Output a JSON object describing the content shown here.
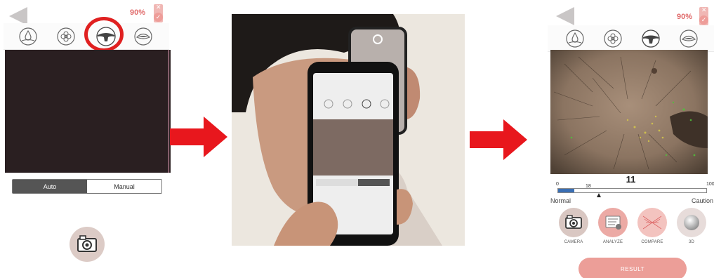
{
  "left_screen": {
    "battery": "90%",
    "modes": [
      {
        "icon": "droplet-icon"
      },
      {
        "icon": "pores-icon"
      },
      {
        "icon": "skin-layer-icon"
      },
      {
        "icon": "eye-icon"
      }
    ],
    "selected_mode_index": 2,
    "capture_modes": [
      "Auto",
      "Manual"
    ],
    "selected_capture_mode": "Auto"
  },
  "right_screen": {
    "battery": "90%",
    "score": "11",
    "scale_min": "0",
    "scale_max": "100",
    "threshold": "18",
    "score_fraction": 0.11,
    "threshold_fraction": 0.18,
    "scale_low_label": "Normal",
    "scale_high_label": "Caution",
    "actions": [
      {
        "label": "CAMERA",
        "icon": "camera-icon"
      },
      {
        "label": "ANALYZE",
        "icon": "analyze-icon"
      },
      {
        "label": "COMPARE",
        "icon": "compare-icon"
      },
      {
        "label": "3D",
        "icon": "3d-sphere-icon"
      }
    ],
    "result_label": "RESULT"
  },
  "colors": {
    "accent_pink": "#ec9e98",
    "highlight_red": "#e02020",
    "arrow_red": "#e8171d",
    "track_blue": "#3a6fb4"
  }
}
